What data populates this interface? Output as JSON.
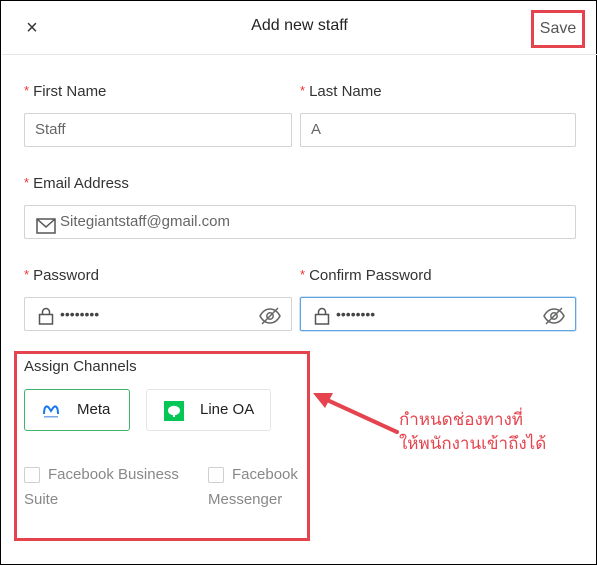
{
  "header": {
    "close_glyph": "×",
    "title": "Add new staff",
    "save_label": "Save"
  },
  "form": {
    "first_name": {
      "label": "First Name",
      "value": "Staff"
    },
    "last_name": {
      "label": "Last Name",
      "value": "A"
    },
    "email": {
      "label": "Email Address",
      "value": "Sitegiantstaff@gmail.com"
    },
    "password": {
      "label": "Password",
      "value": "••••••••"
    },
    "confirm_password": {
      "label": "Confirm Password",
      "value": "••••••••"
    },
    "required_mark": "*"
  },
  "channels": {
    "label": "Assign Channels",
    "items": [
      {
        "label": "Meta",
        "selected": true
      },
      {
        "label": "Line OA",
        "selected": false
      }
    ],
    "options": [
      {
        "line1": "Facebook Business",
        "line2": "Suite",
        "checked": false
      },
      {
        "line1": "Facebook",
        "line2": "Messenger",
        "checked": false
      }
    ]
  },
  "annotation": {
    "line1": "กำหนดช่องทางที่",
    "line2": "ให้พนักงานเข้าถึงได้"
  },
  "colors": {
    "accent_red": "#e5444e",
    "meta_selected_border": "#41b36b",
    "focus_border": "#5fa4e0",
    "line_green": "#06c755"
  }
}
